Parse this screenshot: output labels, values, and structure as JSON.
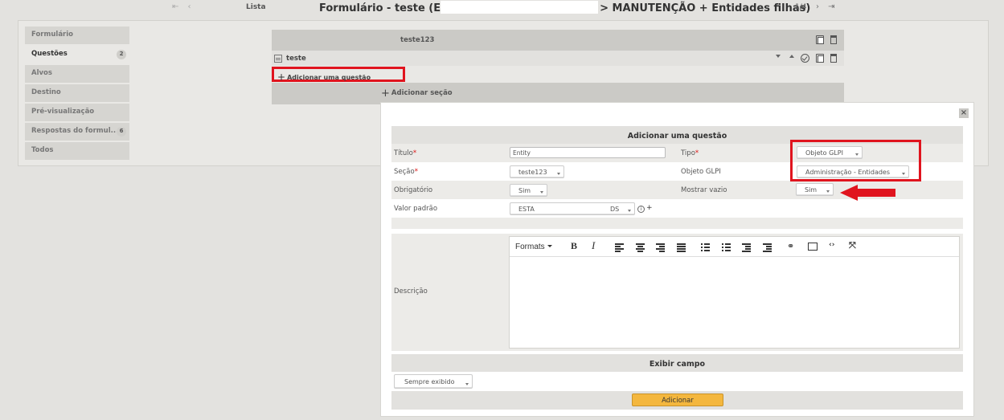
{
  "topbar": {
    "first_prev": "⇤ ‹",
    "lista": "Lista",
    "title_start": "Formulário - teste (E",
    "title_end": "> MANUTENÇÃO + Entidades filhas)",
    "pager": "1/4",
    "next_last": "› ⇥"
  },
  "sidebar": {
    "items": [
      {
        "label": "Formulário"
      },
      {
        "label": "Questões",
        "badge": "2"
      },
      {
        "label": "Alvos"
      },
      {
        "label": "Destino"
      },
      {
        "label": "Pré-visualização"
      },
      {
        "label": "Respostas do formul...",
        "badge": "6"
      },
      {
        "label": "Todos"
      }
    ]
  },
  "section": {
    "title": "teste123",
    "question": "teste",
    "add_question": "Adicionar uma questão",
    "add_section": "Adicionar seção"
  },
  "modal": {
    "close": "×",
    "title": "Adicionar uma questão",
    "fields": {
      "titulo_label": "Título",
      "titulo_value": "Entity",
      "tipo_label": "Tipo",
      "tipo_value": "Objeto GLPI",
      "secao_label": "Seção",
      "secao_value": "teste123",
      "objeto_label": "Objeto GLPI",
      "objeto_value": "Administração - Entidades",
      "obrig_label": "Obrigatório",
      "obrig_value": "Sim",
      "mostrar_label": "Mostrar vazio",
      "mostrar_value": "Sim",
      "valor_label": "Valor padrão",
      "valor_value_a": "ESTA",
      "valor_value_b": "DS",
      "info": "i",
      "plus": "+",
      "required_mark": "*"
    },
    "description_label": "Descrição",
    "editor": {
      "formats": "Formats"
    },
    "exibir_title": "Exibir campo",
    "visibility_value": "Sempre exibido",
    "submit": "Adicionar"
  }
}
